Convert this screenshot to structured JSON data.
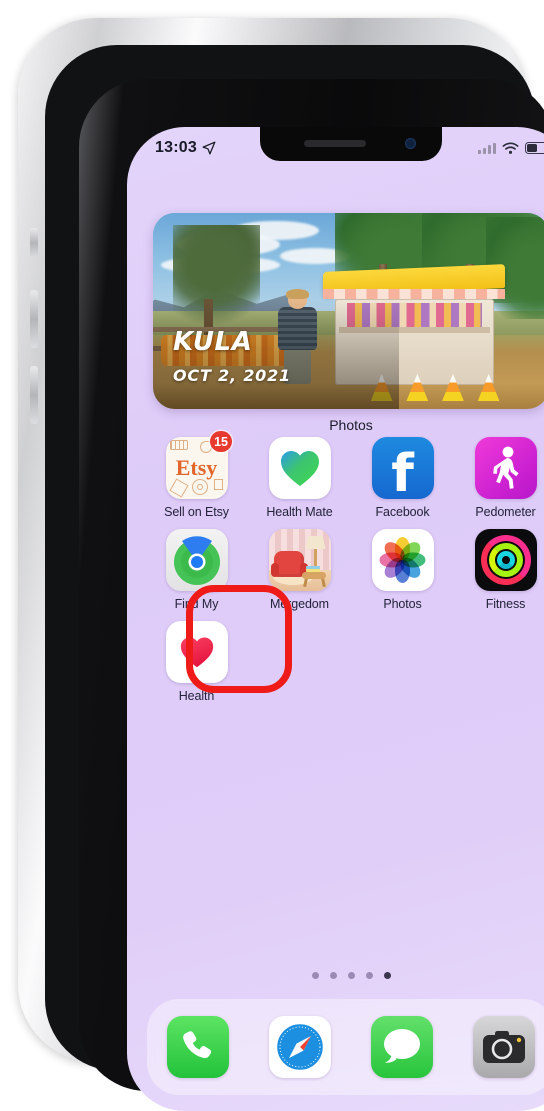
{
  "status_bar": {
    "time": "13:03",
    "location_icon": "location-arrow-icon",
    "signal_icon": "cellular-bars-icon",
    "wifi_icon": "wifi-icon",
    "battery_icon": "battery-icon"
  },
  "widget": {
    "app_label": "Photos",
    "title": "KULA",
    "date": "OCT 2, 2021"
  },
  "apps": [
    [
      {
        "name": "Sell on Etsy",
        "icon": "etsy-icon",
        "badge": "15"
      },
      {
        "name": "Health Mate",
        "icon": "health-mate-icon",
        "badge": ""
      },
      {
        "name": "Facebook",
        "icon": "facebook-icon",
        "badge": ""
      },
      {
        "name": "Pedometer",
        "icon": "pedometer-icon",
        "badge": ""
      }
    ],
    [
      {
        "name": "Find My",
        "icon": "find-my-icon",
        "badge": "",
        "highlighted": true
      },
      {
        "name": "Mergedom",
        "icon": "mergedom-icon",
        "badge": ""
      },
      {
        "name": "Photos",
        "icon": "photos-icon",
        "badge": ""
      },
      {
        "name": "Fitness",
        "icon": "fitness-icon",
        "badge": ""
      }
    ],
    [
      {
        "name": "Health",
        "icon": "health-icon",
        "badge": ""
      }
    ]
  ],
  "page_dots": {
    "count": 5,
    "active_index": 4
  },
  "dock": [
    {
      "name": "Phone",
      "icon": "phone-icon"
    },
    {
      "name": "Safari",
      "icon": "safari-compass-icon"
    },
    {
      "name": "Messages",
      "icon": "messages-bubble-icon"
    },
    {
      "name": "Camera",
      "icon": "camera-icon"
    }
  ],
  "facebook_glyph": "f",
  "colors": {
    "wallpaper": "#decbf8",
    "highlight": "#ee1b18",
    "badge": "#e8392f",
    "label_text": "#23233a"
  }
}
